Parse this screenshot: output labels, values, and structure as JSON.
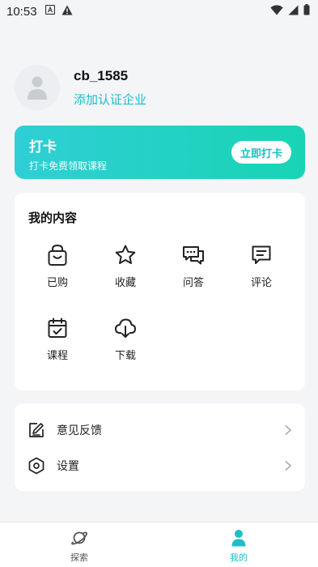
{
  "status_bar": {
    "time": "10:53"
  },
  "profile": {
    "username": "cb_1585",
    "cert_link": "添加认证企业"
  },
  "checkin": {
    "title": "打卡",
    "subtitle": "打卡免费领取课程",
    "button": "立即打卡"
  },
  "my_content": {
    "title": "我的内容",
    "items": [
      {
        "label": "已购",
        "icon": "shopping-bag-icon"
      },
      {
        "label": "收藏",
        "icon": "star-icon"
      },
      {
        "label": "问答",
        "icon": "chat-bubbles-icon"
      },
      {
        "label": "评论",
        "icon": "comment-icon"
      },
      {
        "label": "课程",
        "icon": "calendar-icon"
      },
      {
        "label": "下载",
        "icon": "cloud-download-icon"
      }
    ]
  },
  "settings_list": {
    "items": [
      {
        "label": "意见反馈",
        "icon": "feedback-icon"
      },
      {
        "label": "设置",
        "icon": "hexagon-settings-icon"
      }
    ]
  },
  "bottom_nav": {
    "items": [
      {
        "label": "探索",
        "icon": "planet-icon",
        "active": false
      },
      {
        "label": "我的",
        "icon": "person-icon",
        "active": true
      }
    ]
  },
  "colors": {
    "accent": "#1fbdc4",
    "banner_start": "#2fcfd5",
    "banner_end": "#18d4b4",
    "background": "#f4f5f7",
    "nav_inactive": "#555555"
  }
}
